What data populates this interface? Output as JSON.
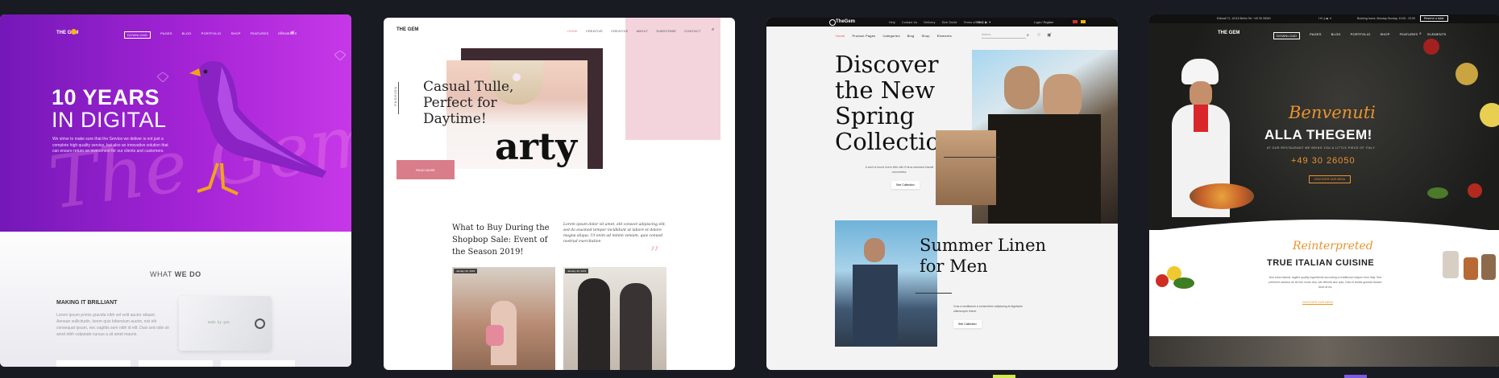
{
  "colors": {
    "page_bg": "#181b22",
    "purple": "#a524d6",
    "pink": "#f3d4dd",
    "rose": "#d97d8b",
    "orange": "#e8942e"
  },
  "card1": {
    "logo": "THE GEM",
    "nav": [
      "DOWNLOAD",
      "PAGES",
      "BLOG",
      "PORTFOLIO",
      "SHOP",
      "FEATURES",
      "ELEMENTS"
    ],
    "headline1": "10 YEARS",
    "headline2": "IN DIGITAL",
    "intro": "We strive to make sure that the Service we deliver is not just a complete high quality service, but also an innovative solution that can ensure return on investment for our clients and customers.",
    "script_bg": "The Gem",
    "what_we_do_a": "WHAT ",
    "what_we_do_b": "WE DO",
    "making_it": "MAKING IT BRILLIANT",
    "lorem": "Lorem ipsum primis gravida nibh vel velit auctor aliquet. Aenean sollicitudin, lorem quis bibendum auctor, nisi elit consequat ipsum, nec sagittis sem nibh id elit. Duis sed odio sit amet nibh vulputate cursus a sit amet mauris.",
    "tag_text": "made by gem"
  },
  "card2": {
    "logo": "THE GEM",
    "nav": [
      "HOME",
      "CREATIVE",
      "CREATIVE",
      "ABOUT",
      "SUBSCRIBE",
      "CONTACT"
    ],
    "side_label": "FASHION",
    "headline": "Casual Tulle, Perfect for Daytime!",
    "read_more": "READ MORE",
    "shirt_text": "arty",
    "article_title": "What to Buy During the Shopbop Sale: Event of the Season 2019!",
    "article_text": "Lorem ipsum dolor sit amet, elit consect adipiscing elit, sed do eiusmod tempor incididunt ut labore et dolore magna aliqua. Ut enim ad minim veniam, quis conuod nostrud exercitation",
    "date1": "January 26, 2019",
    "date2": "January 26, 2019"
  },
  "card3": {
    "logo": "TheGem",
    "topbar": [
      "Help",
      "Contact Us",
      "Delivery",
      "Size Guide",
      "Terms of Sale"
    ],
    "login": "Login / Register",
    "nav": [
      "Home",
      "Product Pages",
      "Categories",
      "Blog",
      "Shop",
      "Elements"
    ],
    "search_placeholder": "Search...",
    "headline": "Discover the New Spring Collection",
    "blurb": "A wish is found lorem elite with Entrus standard blandit consectetur.",
    "see_collection": "See Collection",
    "men_headline": "Summer Linen for Men",
    "men_blurb": "Cras a vestibulum a consectetur adipiscing at dignissim ullamcorper frame.",
    "see_collection2": "See Collection"
  },
  "card4": {
    "topbar_left": "Edimall 71, 10115 Berlin   Tel: +49 30 26050",
    "topbar_right": "Booking hours: Monday-Sunday, 10:00 - 22:00",
    "reserve": "Reserve a table",
    "logo": "THE GEM",
    "nav": [
      "DOWNLOAD",
      "PAGES",
      "BLOG",
      "PORTFOLIO",
      "SHOP",
      "FEATURES",
      "ELEMENTS"
    ],
    "script1": "Benvenuti",
    "title": "ALLA THEGEM!",
    "subtitle": "AT OUR RESTAURANT WE BRING YOU A LITTLE PIECE OF ITALY",
    "phone": "+49 30 26050",
    "menu_btn": "DISCOVER OUR MENU",
    "script2": "Reinterpreted",
    "title2": "TRUE ITALIAN CUISINE",
    "text2": "Nos tulos habeat, tagline quality ingredients according to traditional recipes from Italy. Sed pertinent sanctus an sit fum modo sea, eat offendit atur quis. Duis et tantas gravida fautum doce at ea.",
    "link": "DISCOVER OUR MENU"
  }
}
